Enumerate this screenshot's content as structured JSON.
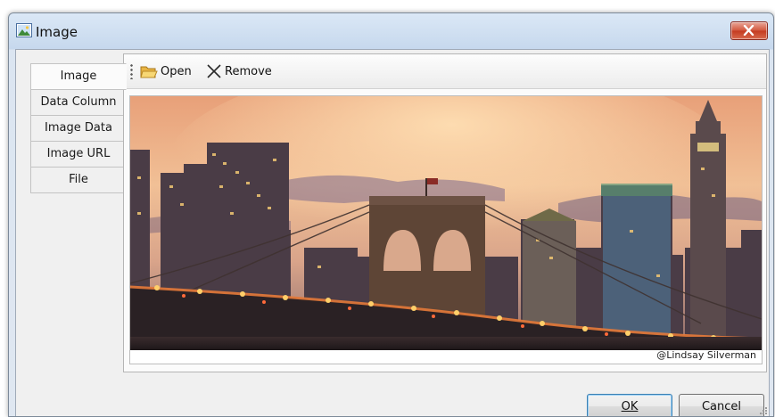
{
  "window": {
    "title": "Image",
    "close_icon": "close-icon"
  },
  "tabs": [
    {
      "label": "Image",
      "active": true
    },
    {
      "label": "Data Column",
      "active": false
    },
    {
      "label": "Image Data",
      "active": false
    },
    {
      "label": "Image URL",
      "active": false
    },
    {
      "label": "File",
      "active": false
    }
  ],
  "toolbar": {
    "open_label": "Open",
    "remove_label": "Remove"
  },
  "image": {
    "credit": "@Lindsay Silverman"
  },
  "buttons": {
    "ok_label": "OK",
    "cancel_label": "Cancel"
  },
  "colors": {
    "title_gradient_top": "#dbe8f6",
    "close_button": "#d2553b",
    "default_button_border": "#3c7fb1"
  }
}
